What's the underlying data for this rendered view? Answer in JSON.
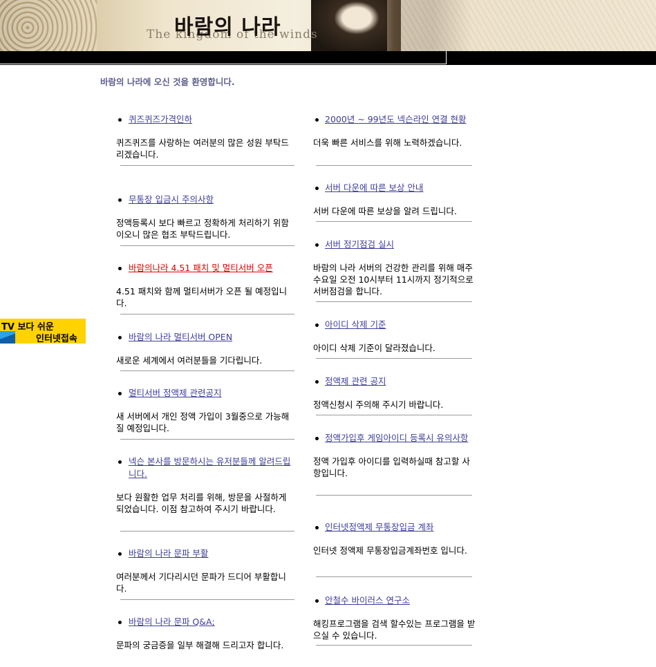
{
  "banner": {
    "title": "바람의 나라",
    "subtitle": "The kingdom of the winds"
  },
  "welcome": "바람의 나라에 오신 것을 환영합니다.",
  "ad": {
    "line1": "TV 보다 쉬운",
    "line2": "인터넷접속"
  },
  "left_news": [
    {
      "title": "퀴즈퀴즈가격인하",
      "desc": "퀴즈퀴즈를 사랑하는 여러분의 많은 성원 부탁드리겠습니다."
    },
    {
      "title": "무통장 입금시 주의사항",
      "desc": "정액등록시 보다 빠르고 정확하게 처리하기 위함이오니 많은 협조 부탁드립니다."
    },
    {
      "title": "바람의나라 4.51 패치 및 멀티서버 오픈",
      "desc": "4.51 패치와 함께 멀티서버가 오픈 될 예정입니다."
    },
    {
      "title": "바람의 나라 멀티서버 OPEN",
      "desc": "새로운 세계에서 여러분들을 기다립니다."
    },
    {
      "title": "멀티서버 정액제 관련공지",
      "desc": "새 서버에서 개인 정액 가입이 3월중으로 가능해 질 예정입니다."
    },
    {
      "title": "넥슨 본사를 방문하시는 유저분들께 알려드립니다.",
      "desc": "보다 원활한 업무 처리를 위해, 방문을 사절하게 되었습니다. 이점 참고하여 주시기 바랍니다."
    },
    {
      "title": "바람의 나라 문파 부활",
      "desc": "여러분께서 기다리시던 문파가 드디어 부활합니다."
    },
    {
      "title": "바람의 나라 문파 Q&A;",
      "desc": "문파의 궁금증을 일부 해결해 드리고자 합니다."
    }
  ],
  "right_news": [
    {
      "title": "2000년 ~ 99년도 넥슨라인 연결 현황",
      "desc": "더욱 빠른 서비스를 위해 노력하겠습니다."
    },
    {
      "title": "서버 다운에 따른 보상 안내",
      "desc": "서버 다운에 따른 보상을 알려 드립니다."
    },
    {
      "title": "서버 정기점검 실시",
      "desc": "바람의 나라 서버의 건강한 관리를 위해 매주 수요일 오전 10시부터 11시까지 정기적으로 서버점검을 합니다."
    },
    {
      "title": "아이디 삭제 기준",
      "desc": "아이디 삭제 기준이 달라졌습니다."
    },
    {
      "title": "정액제 관련 공지",
      "desc": "정액신청시 주의해 주시기 바랍니다."
    },
    {
      "title": "정액가입후 게임아이디 등록시 유의사항",
      "desc": "정액 가입후 아이디를 입력하실때 참고할 사항입니다."
    },
    {
      "title": "인터넷정액제 무통장입금 계좌",
      "desc": "인터넷 정액제 무통장입금계좌번호 입니다."
    },
    {
      "title": "안철수 바이러스 연구소",
      "desc": "해킹프로그램을 검색 할수있는 프로그램을 받으실 수 있습니다."
    }
  ]
}
